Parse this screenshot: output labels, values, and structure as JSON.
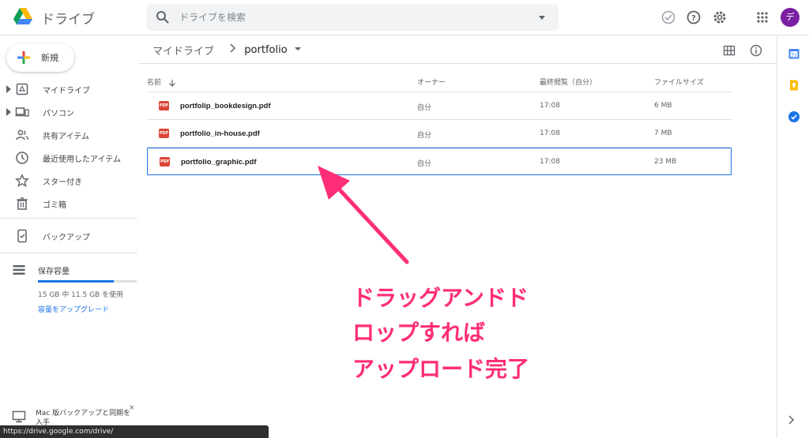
{
  "app": {
    "title": "ドライブ"
  },
  "search": {
    "placeholder": "ドライブを検索"
  },
  "avatar": {
    "initial": "デ",
    "color": "#7b1fa2"
  },
  "sidebar": {
    "new_label": "新規",
    "items": [
      {
        "label": "マイドライブ",
        "icon": "my-drive-icon",
        "expandable": true
      },
      {
        "label": "パソコン",
        "icon": "computers-icon",
        "expandable": true
      },
      {
        "label": "共有アイテム",
        "icon": "shared-icon",
        "expandable": false
      },
      {
        "label": "最近使用したアイテム",
        "icon": "recent-clock-icon",
        "expandable": false
      },
      {
        "label": "スター付き",
        "icon": "star-icon",
        "expandable": false
      },
      {
        "label": "ゴミ箱",
        "icon": "trash-icon",
        "expandable": false
      },
      {
        "label": "バックアップ",
        "icon": "backup-icon",
        "expandable": false
      }
    ],
    "storage": {
      "label": "保存容量",
      "usage_text": "15 GB 中 11.5 GB を使用",
      "used_fraction": 0.77,
      "upgrade_label": "容量をアップグレード"
    }
  },
  "breadcrumb": {
    "root": "マイドライブ",
    "current": "portfolio"
  },
  "table": {
    "headers": {
      "name": "名前",
      "owner": "オーナー",
      "last_viewed": "最終閲覧（自分）",
      "size": "ファイルサイズ"
    },
    "rows": [
      {
        "name": "portfolip_bookdesign.pdf",
        "owner": "自分",
        "viewed": "17:08",
        "size": "6 MB",
        "selected": false
      },
      {
        "name": "portfolio_in-house.pdf",
        "owner": "自分",
        "viewed": "17:08",
        "size": "7 MB",
        "selected": false
      },
      {
        "name": "portfolio_graphic.pdf",
        "owner": "自分",
        "viewed": "17:08",
        "size": "23 MB",
        "selected": true
      }
    ],
    "pdf_badge": "PDF"
  },
  "annotation": {
    "lines": [
      "ドラッグアンドド",
      "ロップすれば",
      "アップロード完了"
    ],
    "color": "#ff2d78"
  },
  "banner": {
    "text": "Mac 版バックアップと同期を入手",
    "close": "×"
  },
  "status_url": "https://drive.google.com/drive/"
}
